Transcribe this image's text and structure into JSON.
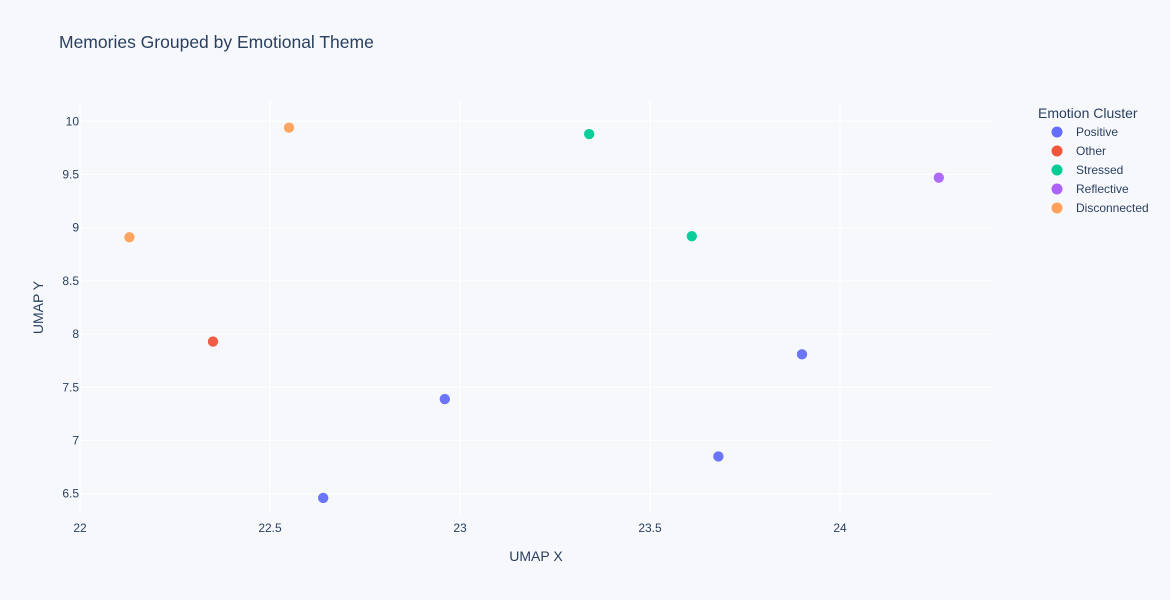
{
  "chart_data": {
    "type": "scatter",
    "title": "Memories Grouped by Emotional Theme",
    "xlabel": "UMAP X",
    "ylabel": "UMAP Y",
    "xlim": [
      22.0,
      24.4
    ],
    "ylim": [
      6.3,
      10.2
    ],
    "x_ticks": [
      22,
      22.5,
      23,
      23.5,
      24
    ],
    "x_tick_labels": [
      "22",
      "22.5",
      "23",
      "23.5",
      "24"
    ],
    "y_ticks": [
      6.5,
      7,
      7.5,
      8,
      8.5,
      9,
      9.5,
      10
    ],
    "y_tick_labels": [
      "6.5",
      "7",
      "7.5",
      "8",
      "8.5",
      "9",
      "9.5",
      "10"
    ],
    "grid": true,
    "legend": {
      "title": "Emotion Cluster",
      "position": "right"
    },
    "series": [
      {
        "name": "Positive",
        "color": "#636efa",
        "points": [
          {
            "x": 22.64,
            "y": 6.46
          },
          {
            "x": 22.96,
            "y": 7.39
          },
          {
            "x": 23.68,
            "y": 6.85
          },
          {
            "x": 23.9,
            "y": 7.81
          }
        ]
      },
      {
        "name": "Other",
        "color": "#ef553b",
        "points": [
          {
            "x": 22.35,
            "y": 7.93
          }
        ]
      },
      {
        "name": "Stressed",
        "color": "#00cc96",
        "points": [
          {
            "x": 23.34,
            "y": 9.88
          },
          {
            "x": 23.61,
            "y": 8.92
          }
        ]
      },
      {
        "name": "Reflective",
        "color": "#ab63fa",
        "points": [
          {
            "x": 24.26,
            "y": 9.47
          }
        ]
      },
      {
        "name": "Disconnected",
        "color": "#ffa15a",
        "points": [
          {
            "x": 22.13,
            "y": 8.91
          },
          {
            "x": 22.55,
            "y": 9.94
          }
        ]
      }
    ]
  }
}
